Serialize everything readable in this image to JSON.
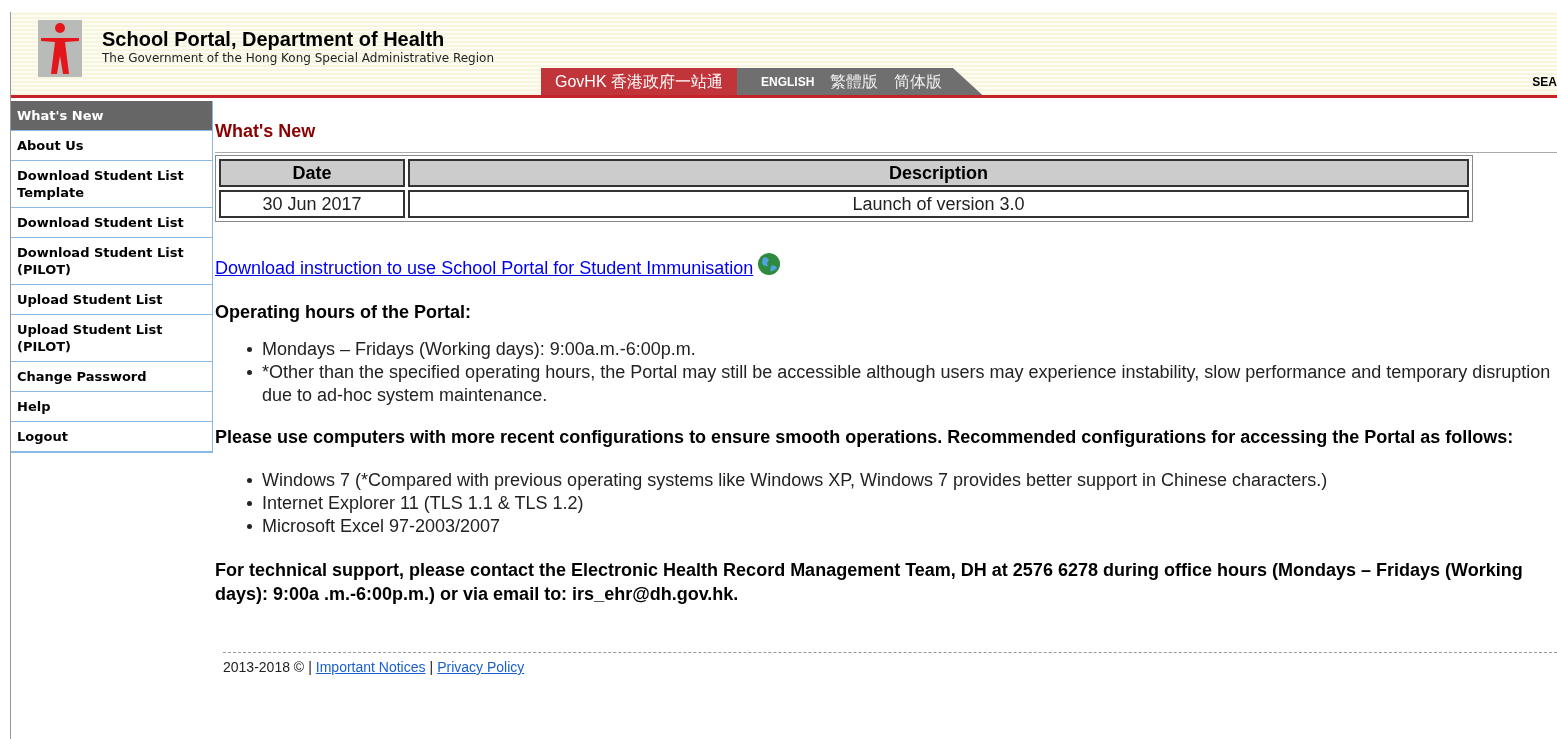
{
  "header": {
    "title": "School Portal, Department of Health",
    "subtitle": "The Government of the Hong Kong Special Administrative Region",
    "govhk": "GovHK 香港政府一站通",
    "languages": [
      {
        "label": "ENGLISH",
        "selected": true
      },
      {
        "label": "繁體版",
        "selected": false
      },
      {
        "label": "简体版",
        "selected": false
      }
    ],
    "search": "SEA"
  },
  "sidebar": {
    "items": [
      {
        "label": "What's New",
        "selected": true
      },
      {
        "label": "About Us",
        "selected": false
      },
      {
        "label": "Download Student List Template",
        "selected": false
      },
      {
        "label": "Download Student List",
        "selected": false
      },
      {
        "label": "Download Student List (PILOT)",
        "selected": false
      },
      {
        "label": "Upload Student List",
        "selected": false
      },
      {
        "label": "Upload Student List (PILOT)",
        "selected": false
      },
      {
        "label": "Change Password",
        "selected": false
      },
      {
        "label": "Help",
        "selected": false
      },
      {
        "label": "Logout",
        "selected": false
      }
    ]
  },
  "main": {
    "heading": "What's New",
    "table": {
      "columns": [
        "Date",
        "Description"
      ],
      "rows": [
        [
          "30 Jun 2017",
          "Launch of version 3.0"
        ]
      ]
    },
    "download_link": "Download instruction to use School Portal for Student Immunisation",
    "hours_heading": "Operating hours of the Portal:",
    "hours_list": [
      "Mondays – Fridays (Working days): 9:00a.m.-6:00p.m.",
      "*Other than the specified operating hours, the Portal may still be accessible although users may experience instability, slow performance and temporary disruption due to ad-hoc system maintenance."
    ],
    "config_heading": "Please use computers with more recent configurations to ensure smooth operations. Recommended configurations for accessing the Portal as follows:",
    "config_list": [
      "Windows 7 (*Compared with previous operating systems like Windows XP, Windows 7 provides better support in Chinese characters.)",
      "Internet Explorer 11 (TLS 1.1 & TLS 1.2)",
      "Microsoft Excel 97-2003/2007"
    ],
    "support_text": "For technical support, please contact the Electronic Health Record Management Team, DH at 2576 6278 during office hours (Mondays – Fridays (Working days): 9:00a .m.-6:00p.m.) or via email to: irs_ehr@dh.gov.hk."
  },
  "footer": [
    {
      "kind": "text",
      "text": "2013-2018 ©"
    },
    {
      "kind": "text",
      "text": "|"
    },
    {
      "kind": "link",
      "text": "Important Notices"
    },
    {
      "kind": "text",
      "text": "|"
    },
    {
      "kind": "link",
      "text": "Privacy Policy"
    }
  ]
}
